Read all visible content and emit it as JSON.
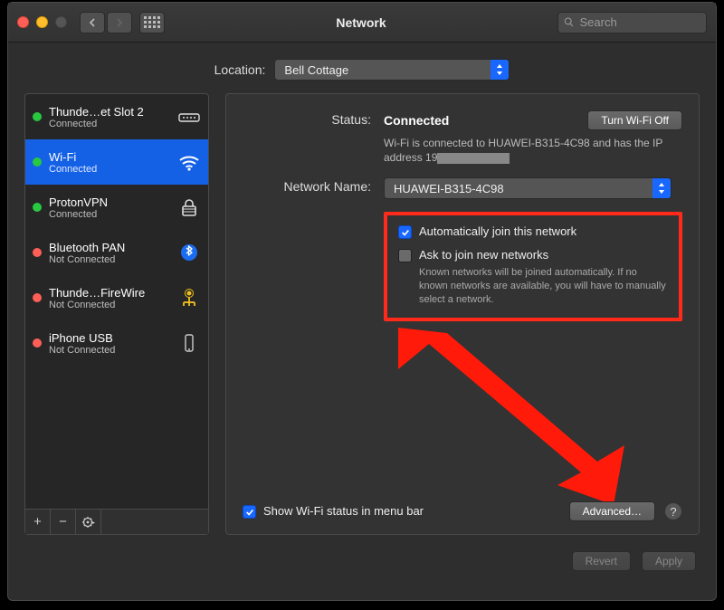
{
  "window": {
    "title": "Network"
  },
  "search": {
    "placeholder": "Search"
  },
  "location": {
    "label": "Location:",
    "value": "Bell Cottage"
  },
  "sidebar": {
    "items": [
      {
        "name": "Thunde…et Slot 2",
        "status": "Connected",
        "dot": "green",
        "icon": "ethernet-icon"
      },
      {
        "name": "Wi-Fi",
        "status": "Connected",
        "dot": "green",
        "icon": "wifi-icon"
      },
      {
        "name": "ProtonVPN",
        "status": "Connected",
        "dot": "green",
        "icon": "lock-icon"
      },
      {
        "name": "Bluetooth PAN",
        "status": "Not Connected",
        "dot": "red",
        "icon": "bluetooth-icon"
      },
      {
        "name": "Thunde…FireWire",
        "status": "Not Connected",
        "dot": "red",
        "icon": "firewire-icon"
      },
      {
        "name": "iPhone USB",
        "status": "Not Connected",
        "dot": "red",
        "icon": "phone-icon"
      }
    ]
  },
  "main": {
    "status_label": "Status:",
    "status_value": "Connected",
    "wifi_toggle": "Turn Wi-Fi Off",
    "status_desc_prefix": "Wi-Fi is connected to HUAWEI-B315-4C98 and has the IP address 19",
    "network_name_label": "Network Name:",
    "network_name_value": "HUAWEI-B315-4C98",
    "auto_join_label": "Automatically join this network",
    "ask_join_label": "Ask to join new networks",
    "ask_join_hint": "Known networks will be joined automatically. If no known networks are available, you will have to manually select a network.",
    "show_menubar_label": "Show Wi-Fi status in menu bar",
    "advanced_label": "Advanced…"
  },
  "footer": {
    "revert": "Revert",
    "apply": "Apply"
  }
}
